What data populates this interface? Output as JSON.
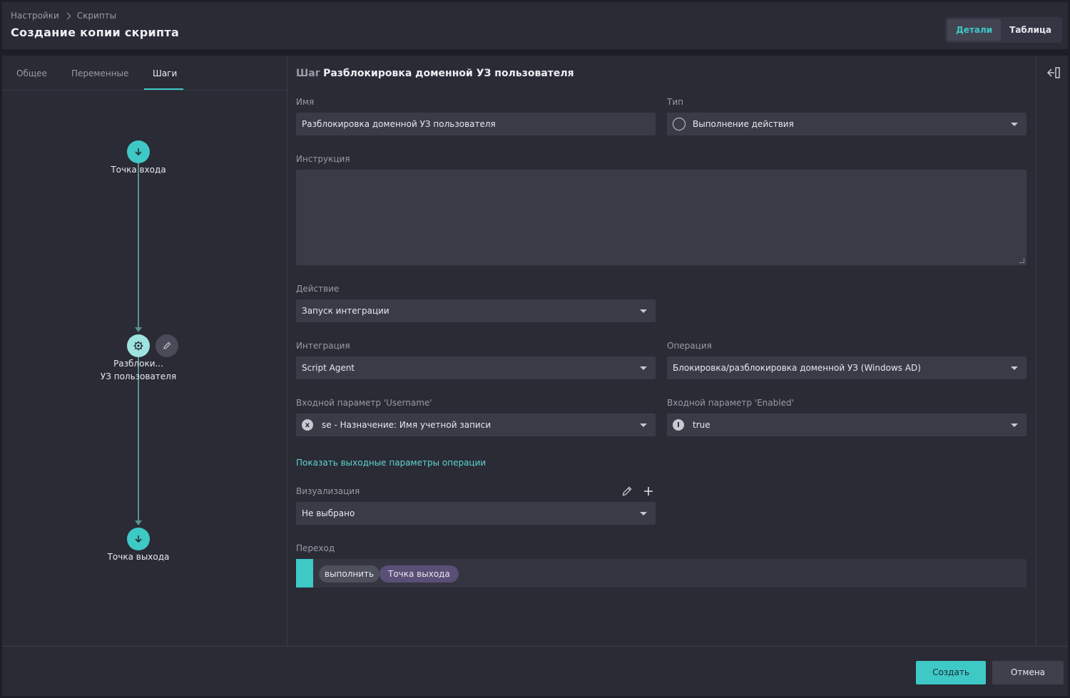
{
  "header": {
    "breadcrumb": [
      "Настройки",
      "Скрипты"
    ],
    "title": "Создание копии скрипта",
    "view_options": [
      "Детали",
      "Таблица"
    ],
    "view_active": "Детали"
  },
  "tabs": [
    "Общее",
    "Переменные",
    "Шаги"
  ],
  "tab_active": "Шаги",
  "flow": {
    "entry_label": "Точка входа",
    "step_label_line1": "Разблоки...",
    "step_label_line2": "УЗ пользователя",
    "exit_label": "Точка выхода"
  },
  "step": {
    "title_prefix": "Шаг",
    "title": "Разблокировка доменной УЗ пользователя",
    "name_label": "Имя",
    "name_value": "Разблокировка доменной УЗ пользователя",
    "type_label": "Тип",
    "type_value": "Выполнение действия",
    "instruction_label": "Инструкция",
    "instruction_value": "",
    "action_label": "Действие",
    "action_value": "Запуск интеграции",
    "integration_label": "Интеграция",
    "integration_value": "Script Agent",
    "operation_label": "Операция",
    "operation_value": "Блокировка/разблокировка доменной УЗ (Windows AD)",
    "param_username_label": "Входной параметр 'Username'",
    "param_username_value": "se - Назначение: Имя учетной записи",
    "param_enabled_label": "Входной параметр 'Enabled'",
    "param_enabled_value": "true",
    "show_output_link": "Показать выходные параметры операции",
    "visualization_label": "Визуализация",
    "visualization_value": "Не выбрано",
    "transition_label": "Переход",
    "transition_pills": [
      "выполнить",
      "Точка выхода"
    ]
  },
  "footer": {
    "create_label": "Создать",
    "cancel_label": "Отмена"
  },
  "colors": {
    "accent": "#3ec9c6",
    "background": "#2a2b35",
    "field": "#3a3b47",
    "pill_purple": "#5a4f77"
  }
}
